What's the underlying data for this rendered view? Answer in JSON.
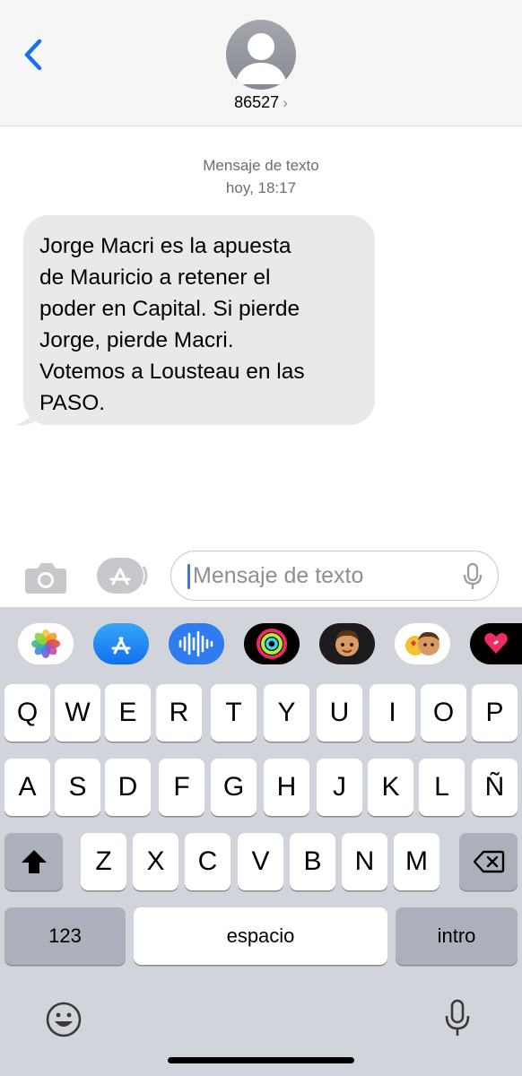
{
  "header": {
    "contact": "86527",
    "back_icon": "chevron-left-icon",
    "avatar_icon": "person-silhouette-icon",
    "chevron_icon": "chevron-right-icon"
  },
  "thread": {
    "service_label": "Mensaje de texto",
    "timestamp": "hoy, 18:17",
    "message": "Jorge Macri es la apuesta\nde Mauricio a retener el\npoder en Capital. Si pierde\nJorge, pierde Macri.\nVotemos a Lousteau en las\nPASO."
  },
  "compose": {
    "placeholder": "Mensaje de texto",
    "icons": [
      "camera-icon",
      "app-store-icon",
      "microphone-icon"
    ]
  },
  "app_drawer": {
    "apps": [
      "photos-icon",
      "app-store-icon",
      "audio-message-icon",
      "activity-icon",
      "memoji-icon",
      "memoji-stickers-icon",
      "digital-touch-icon"
    ]
  },
  "keyboard": {
    "row1": [
      "Q",
      "W",
      "E",
      "R",
      "T",
      "Y",
      "U",
      "I",
      "O",
      "P"
    ],
    "row2": [
      "A",
      "S",
      "D",
      "F",
      "G",
      "H",
      "J",
      "K",
      "L",
      "Ñ"
    ],
    "row3": [
      "Z",
      "X",
      "C",
      "V",
      "B",
      "N",
      "M"
    ],
    "numbers_label": "123",
    "space_label": "espacio",
    "return_label": "intro",
    "shift_icon": "shift-icon",
    "delete_icon": "delete-icon",
    "emoji_icon": "emoji-icon",
    "dictation_icon": "microphone-icon"
  },
  "colors": {
    "accent": "#1a6ef5",
    "bubble": "#e9e9eb",
    "keyboard_bg": "#d1d4db"
  }
}
